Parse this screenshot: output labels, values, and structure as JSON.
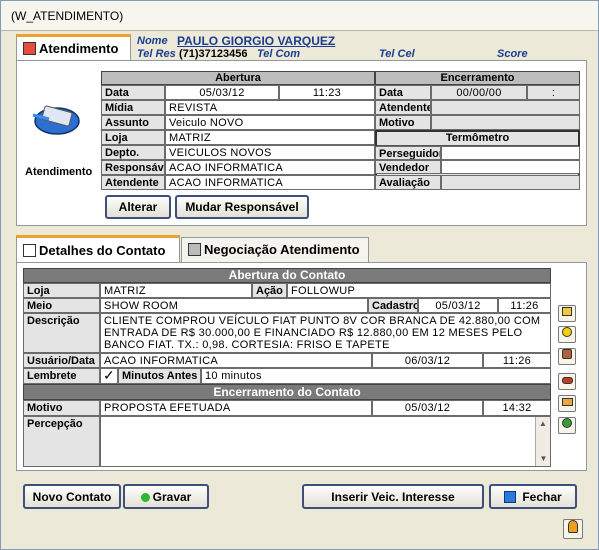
{
  "window": {
    "title": "(W_ATENDIMENTO)"
  },
  "tabs_top": [
    {
      "label": "Atendimento"
    }
  ],
  "contact": {
    "nome_label": "Nome",
    "nome": "PAULO GIORGIO VARQUEZ",
    "telres_label": "Tel Res",
    "telres": "(71)37123456",
    "telcom_label": "Tel Com",
    "telcel_label": "Tel Cel",
    "score_label": "Score"
  },
  "icon_caption": "Atendimento",
  "abertura": {
    "header": "Abertura",
    "rows": [
      {
        "label": "Data",
        "value": "05/03/12",
        "extra": "11:23"
      },
      {
        "label": "Mídia",
        "value": "REVISTA"
      },
      {
        "label": "Assunto",
        "value": "Veiculo NOVO"
      },
      {
        "label": "Loja",
        "value": "MATRIZ"
      },
      {
        "label": "Depto.",
        "value": "VEICULOS NOVOS"
      },
      {
        "label": "Responsável",
        "value": "ACAO INFORMATICA"
      },
      {
        "label": "Atendente",
        "value": "ACAO INFORMATICA"
      }
    ]
  },
  "encerramento": {
    "header": "Encerramento",
    "data_label": "Data",
    "data_value": "00/00/00",
    "time_value": ":",
    "atendente_label": "Atendente",
    "motivo_label": "Motivo"
  },
  "termometro": {
    "header": "Termômetro",
    "perseguidor_label": "Perseguidor",
    "vendedor_label": "Vendedor",
    "avaliacao_label": "Avaliação"
  },
  "buttons_top": {
    "alterar": "Alterar",
    "mudar": "Mudar Responsável"
  },
  "tabs_bottom": [
    {
      "label": "Detalhes do Contato"
    },
    {
      "label": "Negociação Atendimento"
    }
  ],
  "detalhes": {
    "abertura_header": "Abertura do Contato",
    "loja_label": "Loja",
    "loja": "MATRIZ",
    "acao_label": "Ação",
    "acao": "FOLLOWUP",
    "meio_label": "Meio",
    "meio": "SHOW ROOM",
    "cadastro_label": "Cadastro",
    "cadastro_data": "05/03/12",
    "cadastro_hora": "11:26",
    "descricao_label": "Descrição",
    "descricao_lines": [
      "CLIENTE COMPROU VEÍCULO FIAT PUNTO 8V COR BRANCA DE 42.880,00 COM",
      "ENTRADA DE R$ 30.000,00 E FINANCIADO R$ 12.880,00 EM 12 MESES PELO",
      "BANCO FIAT. TX.: 0,98. CORTESIA: FRISO E TAPETE"
    ],
    "usuario_label": "Usuário/Data",
    "usuario": "ACAO INFORMATICA",
    "usuario_data": "06/03/12",
    "usuario_hora": "11:26",
    "lembrete_label": "Lembrete",
    "lembrete_check": "✓",
    "minutos_label": "Minutos Antes",
    "minutos_value": "10 minutos",
    "encerramento_header": "Encerramento do Contato",
    "motivo_label": "Motivo",
    "motivo": "PROPOSTA EFETUADA",
    "motivo_data": "05/03/12",
    "motivo_hora": "14:32",
    "percepcao_label": "Percepção"
  },
  "buttons_bottom": {
    "novo": "Novo Contato",
    "gravar": "Gravar",
    "inserir": "Inserir Veic. Interesse",
    "fechar": "Fechar"
  },
  "scroll": {
    "up": "▲",
    "down": "▼"
  }
}
